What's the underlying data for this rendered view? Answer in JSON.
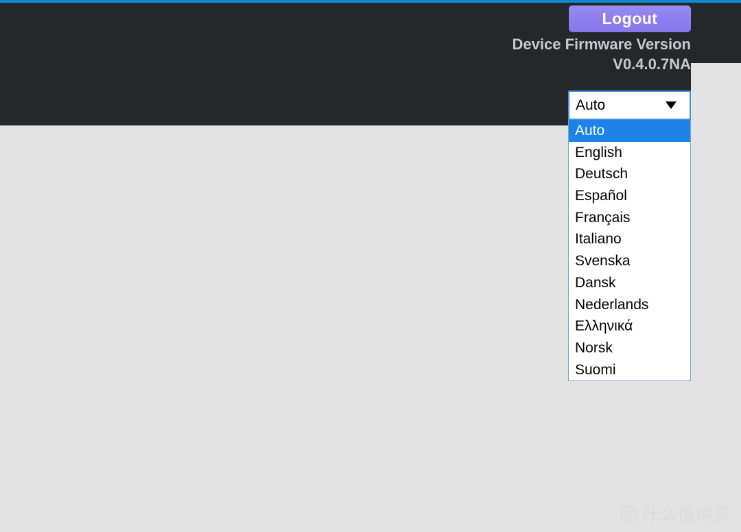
{
  "theme": {
    "accent_bar_color": "#1189cf",
    "header_bg_color": "#25282b",
    "page_bg_color": "#e3e3e3",
    "logout_button_color": "#8f7eee",
    "select_focus_border_color": "#4a90d9",
    "option_highlight_color": "#1d83e8"
  },
  "header": {
    "logout_label": "Logout",
    "firmware_label": "Device Firmware Version",
    "firmware_value": "V0.4.0.7NA"
  },
  "language_select": {
    "selected_value": "Auto",
    "arrow_icon": "chevron-down-icon",
    "expanded": true,
    "options": [
      {
        "label": "Auto",
        "selected": true
      },
      {
        "label": "English",
        "selected": false
      },
      {
        "label": "Deutsch",
        "selected": false
      },
      {
        "label": "Español",
        "selected": false
      },
      {
        "label": "Français",
        "selected": false
      },
      {
        "label": "Italiano",
        "selected": false
      },
      {
        "label": "Svenska",
        "selected": false
      },
      {
        "label": "Dansk",
        "selected": false
      },
      {
        "label": "Nederlands",
        "selected": false
      },
      {
        "label": "Ελληνικά",
        "selected": false
      },
      {
        "label": "Norsk",
        "selected": false
      },
      {
        "label": "Suomi",
        "selected": false
      }
    ]
  },
  "watermark": {
    "badge_char": "值",
    "text": "什么值得买"
  }
}
